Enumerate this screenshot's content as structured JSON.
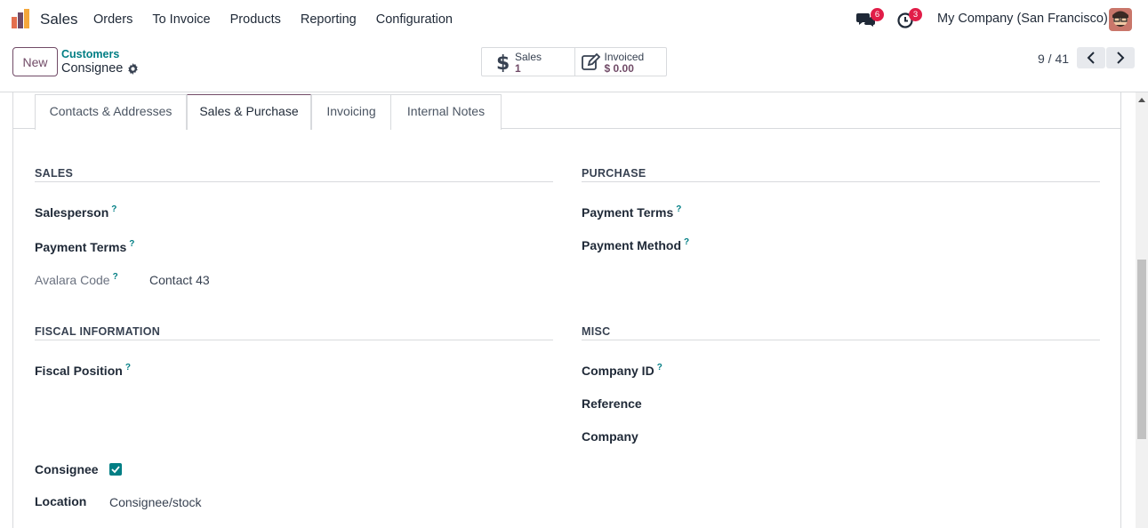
{
  "navbar": {
    "app_name": "Sales",
    "menu": [
      "Orders",
      "To Invoice",
      "Products",
      "Reporting",
      "Configuration"
    ],
    "messages_count": "6",
    "activities_count": "3",
    "company": "My Company (San Francisco)",
    "icons": {
      "app": "sales-app-icon",
      "chat": "chat-icon",
      "activity": "clock-icon"
    }
  },
  "control": {
    "new_label": "New",
    "breadcrumb": "Customers",
    "record": "Consignee",
    "smart_buttons": [
      {
        "label": "Sales",
        "value": "1",
        "icon": "dollar-icon"
      },
      {
        "label": "Invoiced",
        "value": "$ 0.00",
        "icon": "edit-icon"
      }
    ],
    "pager": "9 / 41"
  },
  "tabs": [
    "Contacts & Addresses",
    "Sales & Purchase",
    "Invoicing",
    "Internal Notes"
  ],
  "active_tab": "Sales & Purchase",
  "sales": {
    "title": "SALES",
    "salesperson": "Salesperson",
    "payment_terms": "Payment Terms",
    "avalara_label": "Avalara Code",
    "avalara_value": "Contact 43"
  },
  "purchase": {
    "title": "PURCHASE",
    "payment_terms": "Payment Terms",
    "payment_method": "Payment Method"
  },
  "fiscal": {
    "title": "FISCAL INFORMATION",
    "fiscal_position": "Fiscal Position"
  },
  "misc": {
    "title": "MISC",
    "company_id": "Company ID",
    "reference": "Reference",
    "company": "Company"
  },
  "consignee": {
    "label": "Consignee",
    "checked": true,
    "location_label": "Location",
    "location_value": "Consignee/stock"
  },
  "help_mark": "?",
  "colors": {
    "brand": "#714b67",
    "accent": "#017e84",
    "badge": "#e11d48"
  }
}
